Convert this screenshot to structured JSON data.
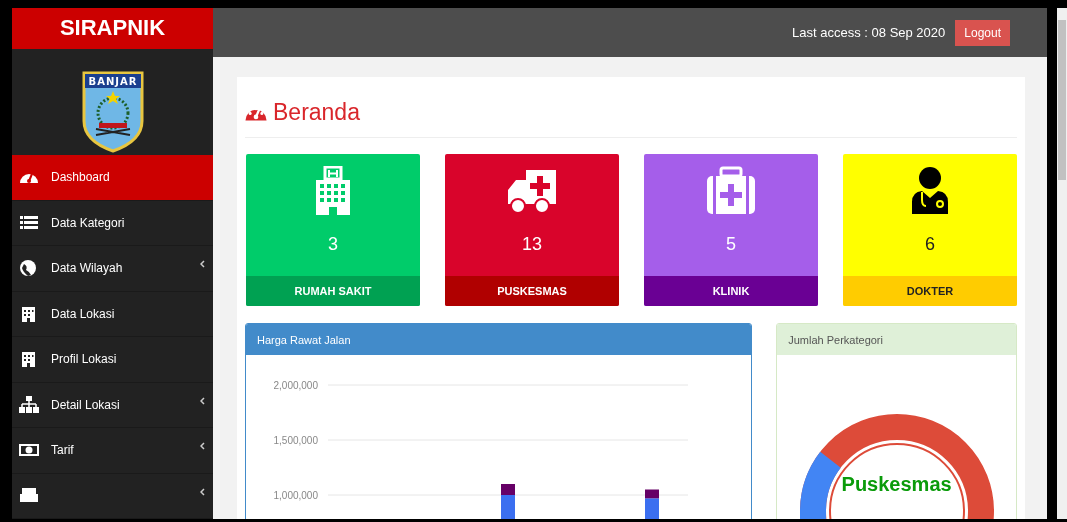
{
  "brand": "SIRAPNIK",
  "logo": {
    "text": "BANJAR"
  },
  "sidebar": {
    "items": [
      {
        "label": "Dashboard",
        "selected": true,
        "has_submenu": false
      },
      {
        "label": "Data Kategori",
        "selected": false,
        "has_submenu": false
      },
      {
        "label": "Data Wilayah",
        "selected": false,
        "has_submenu": true
      },
      {
        "label": "Data Lokasi",
        "selected": false,
        "has_submenu": false
      },
      {
        "label": "Profil Lokasi",
        "selected": false,
        "has_submenu": false
      },
      {
        "label": "Detail Lokasi",
        "selected": false,
        "has_submenu": true
      },
      {
        "label": "Tarif",
        "selected": false,
        "has_submenu": true
      },
      {
        "selected": false,
        "has_submenu": true
      }
    ]
  },
  "header": {
    "last_access": "Last access : 08 Sep 2020",
    "logout": "Logout"
  },
  "page_title": "Beranda",
  "stats": [
    {
      "value": "3",
      "label": "RUMAH SAKIT",
      "color": "#00cc6a"
    },
    {
      "value": "13",
      "label": "PUSKESMAS",
      "color": "#d9042b"
    },
    {
      "value": "5",
      "label": "KLINIK",
      "color": "#a55eea"
    },
    {
      "value": "6",
      "label": "DOKTER",
      "color": "#ffff00"
    }
  ],
  "price_panel": {
    "title": "Harga Rawat Jalan",
    "chart_data": {
      "type": "bar",
      "stacked": true,
      "ylim": [
        0,
        2000000
      ],
      "grid": true,
      "yticks": [
        {
          "value": 1000000,
          "label": "1,000,000"
        },
        {
          "value": 1500000,
          "label": "1,500,000"
        },
        {
          "value": 2000000,
          "label": "2,000,000"
        }
      ],
      "series": [
        {
          "color": "#3b6ff0",
          "values": [
            null,
            null,
            1000000,
            null,
            970000
          ]
        },
        {
          "color": "#660066",
          "values": [
            null,
            null,
            100000,
            null,
            80000
          ]
        }
      ]
    }
  },
  "category_panel": {
    "title": "Jumlah Perkategori",
    "center_label": "Puskesmas"
  }
}
